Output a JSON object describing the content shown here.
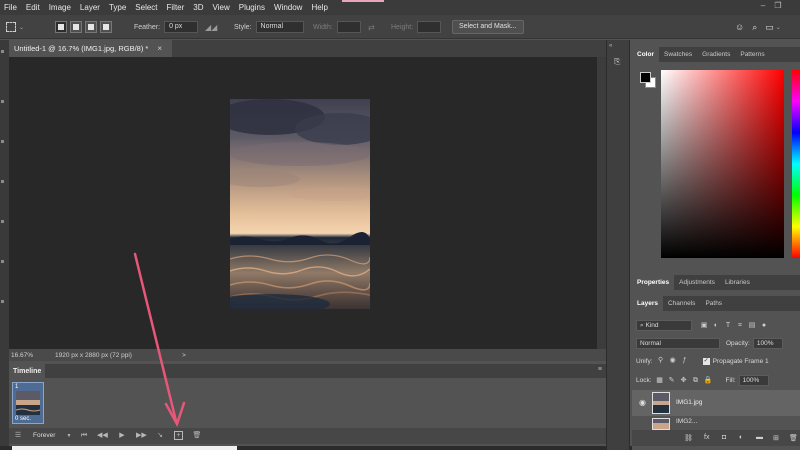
{
  "menu": {
    "items": [
      "File",
      "Edit",
      "Image",
      "Layer",
      "Type",
      "Select",
      "Filter",
      "3D",
      "View",
      "Plugins",
      "Window",
      "Help"
    ]
  },
  "options_bar": {
    "feather_label": "Feather:",
    "feather_value": "0 px",
    "style_label": "Style:",
    "style_value": "Normal",
    "width_label": "Width:",
    "height_label": "Height:",
    "select_mask_label": "Select and Mask..."
  },
  "document": {
    "tab_title": "Untitled-1 @ 16.7% (IMG1.jpg, RGB/8) *",
    "close_glyph": "×"
  },
  "status": {
    "zoom": "16.67%",
    "doc_info": "1920 px x 2880 px (72 ppi)",
    "arrow": ">"
  },
  "timeline": {
    "title": "Timeline",
    "frame_number": "1",
    "frame_duration": "0 sec.",
    "loop_label": "Forever"
  },
  "color_panel": {
    "tabs": [
      "Color",
      "Swatches",
      "Gradients",
      "Patterns"
    ],
    "foreground": "#000000",
    "background": "#ffffff"
  },
  "properties_tabs": [
    "Properties",
    "Adjustments",
    "Libraries"
  ],
  "layers_panel": {
    "tabs": [
      "Layers",
      "Channels",
      "Paths"
    ],
    "filter_label": "Kind",
    "blend_mode": "Normal",
    "opacity_label": "Opacity:",
    "opacity_value": "100%",
    "unify_label": "Unify:",
    "propagate_label": "Propagate Frame 1",
    "lock_label": "Lock:",
    "fill_label": "Fill:",
    "fill_value": "100%",
    "layers": [
      "IMG1.jpg",
      "IMG2..."
    ]
  },
  "annotation": {
    "arrow_color": "#e8577a"
  }
}
